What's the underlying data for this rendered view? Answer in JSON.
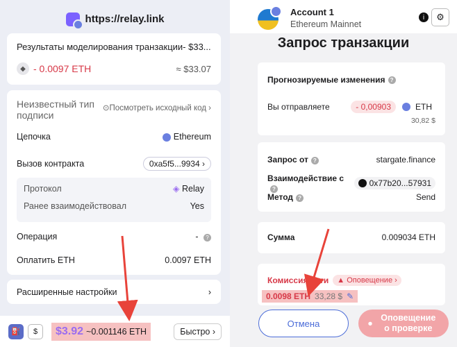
{
  "left": {
    "site_url": "https://relay.link",
    "simulation": {
      "title": "Результаты моделирования транзакции- $33....",
      "amount": "- 0.0097 ETH",
      "usd": "≈ $33.07"
    },
    "details": {
      "type_label": "Неизвестный тип подписи",
      "view_source": "Посмотреть исходный код",
      "chain_label": "Цепочка",
      "chain_value": "Ethereum",
      "contract_label": "Вызов контракта",
      "contract_value": "0xa5f5...9934",
      "protocol_label": "Протокол",
      "protocol_value": "Relay",
      "interacted_label": "Ранее взаимодействовал",
      "interacted_value": "Yes",
      "operation_label": "Операция",
      "operation_value": "-",
      "pay_label": "Оплатить ETH",
      "pay_value": "0.0097 ETH"
    },
    "advanced_settings": "Расширенные настройки",
    "footer": {
      "fee_usd": "$3.92",
      "fee_eth": "~0.001146 ETH",
      "speed": "Быстро"
    }
  },
  "right": {
    "account_name": "Account 1",
    "network": "Ethereum Mainnet",
    "title": "Запрос транзакции",
    "changes": {
      "label": "Прогнозируемые изменения",
      "send_label": "Вы отправляете",
      "send_amount": "- 0,00903",
      "token": "ETH",
      "usd": "30,82 $"
    },
    "request": {
      "from_label": "Запрос от",
      "from_value": "stargate.finance",
      "interact_label": "Взаимодействие с",
      "interact_value": "0x77b20...57931",
      "method_label": "Метод",
      "method_value": "Send"
    },
    "amount": {
      "label": "Сумма",
      "value": "0.009034 ETH"
    },
    "fee": {
      "label": "Комиссия сети",
      "warning": "Оповещение",
      "eth": "0.0098 ETH",
      "usd": "33,28 $"
    },
    "buttons": {
      "cancel": "Отмена",
      "review": "Оповещение о проверке"
    }
  }
}
